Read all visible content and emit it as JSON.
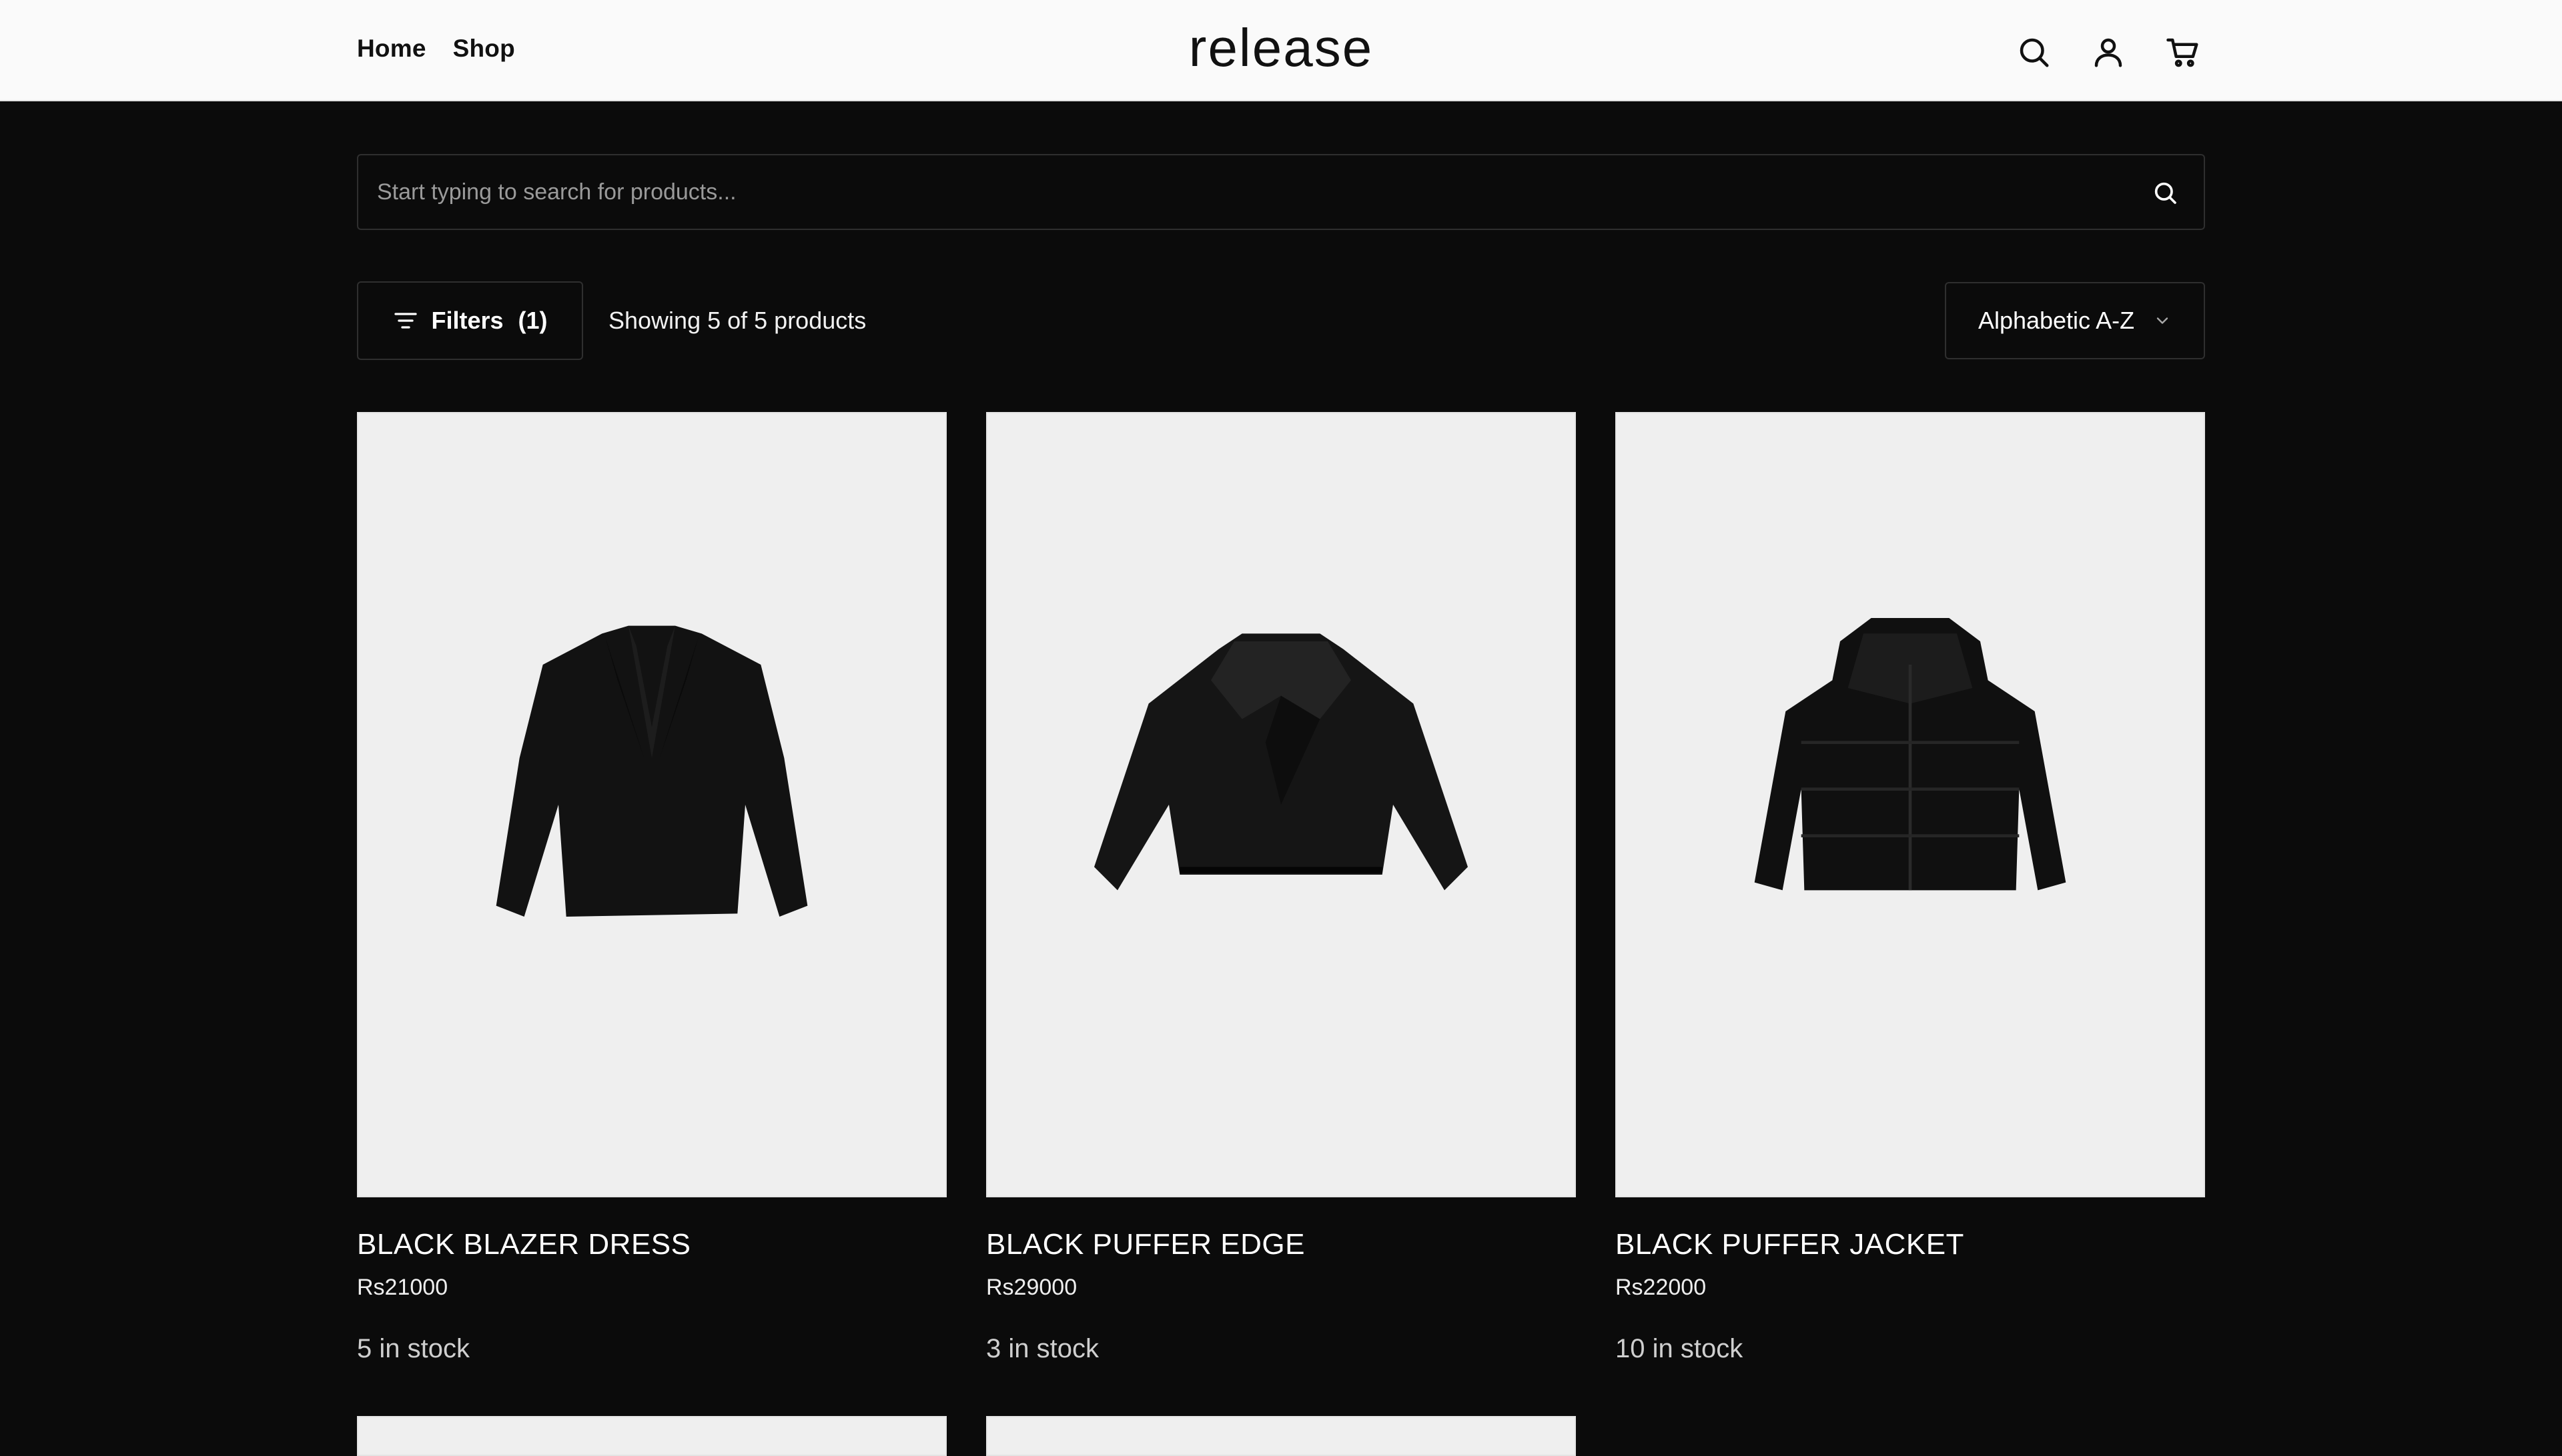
{
  "header": {
    "nav": [
      {
        "label": "Home"
      },
      {
        "label": "Shop"
      }
    ],
    "logo": "release",
    "icons": [
      "search-icon",
      "user-icon",
      "cart-icon"
    ]
  },
  "search": {
    "placeholder": "Start typing to search for products..."
  },
  "toolbar": {
    "filters_label": "Filters",
    "filters_count": "(1)",
    "showing_text": "Showing 5 of 5 products",
    "sort_label": "Alphabetic A-Z"
  },
  "products": [
    {
      "name": "BLACK BLAZER DRESS",
      "price": "Rs21000",
      "stock": "5 in stock",
      "image": "blazer-dress"
    },
    {
      "name": "BLACK PUFFER EDGE",
      "price": "Rs29000",
      "stock": "3 in stock",
      "image": "puffer-edge"
    },
    {
      "name": "BLACK PUFFER JACKET",
      "price": "Rs22000",
      "stock": "10 in stock",
      "image": "puffer-jacket"
    }
  ],
  "colors": {
    "background": "#0b0b0b",
    "header_bg": "#fafafa",
    "card_image_bg": "#efefef",
    "border": "#2f2f2f"
  }
}
